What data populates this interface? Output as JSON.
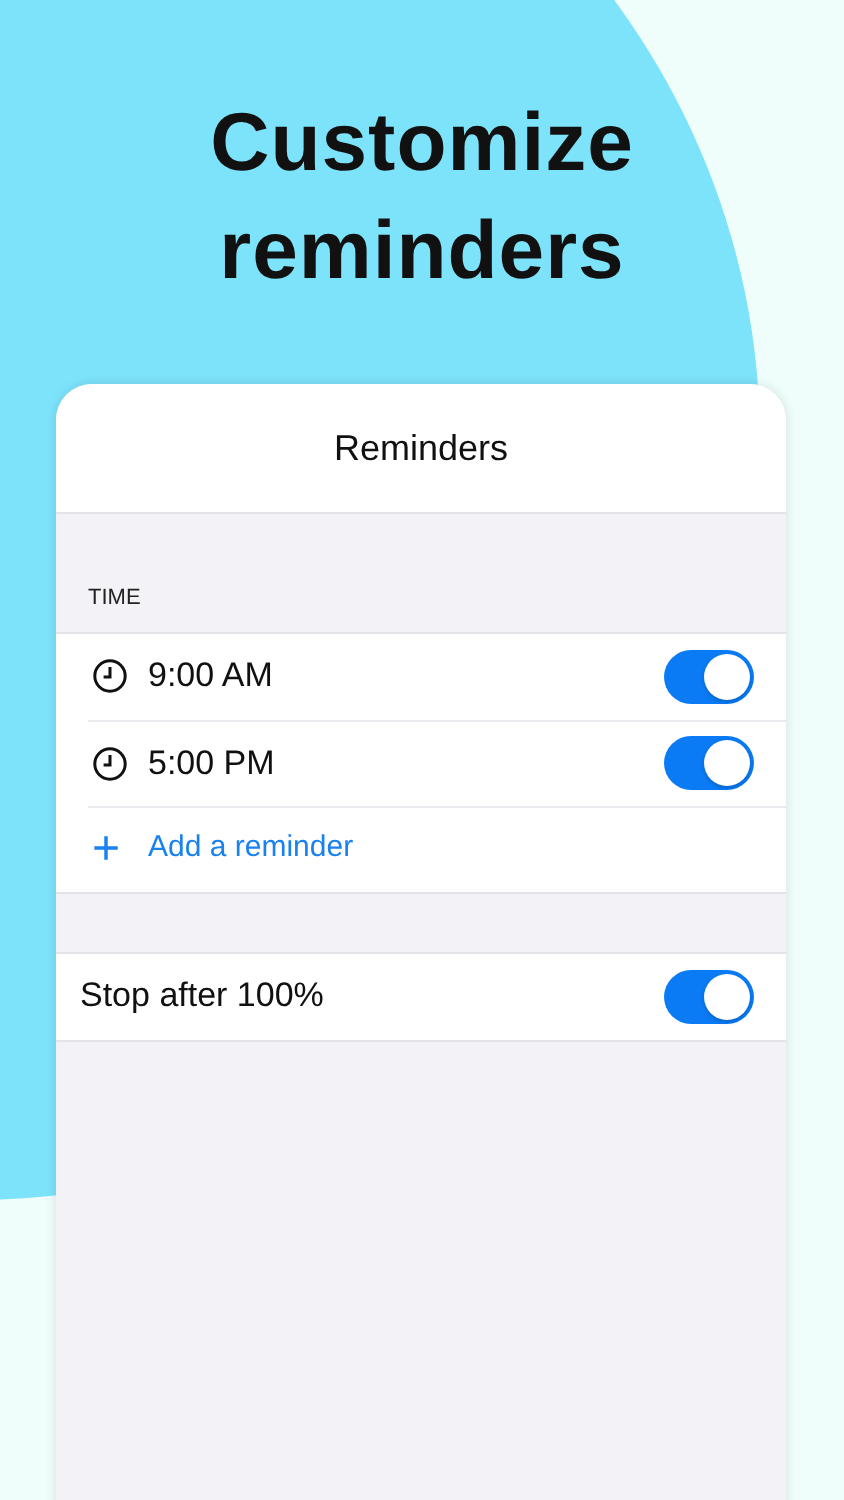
{
  "headline": "Customize reminders",
  "screen": {
    "title": "Reminders",
    "time_section": {
      "header": "TIME",
      "reminders": [
        {
          "time": "9:00 AM",
          "on": true
        },
        {
          "time": "5:00 PM",
          "on": true
        }
      ],
      "add_button": {
        "icon": "+",
        "label": "Add a reminder"
      }
    },
    "settings": [
      {
        "label": "Stop after 100%",
        "on": true
      }
    ]
  }
}
